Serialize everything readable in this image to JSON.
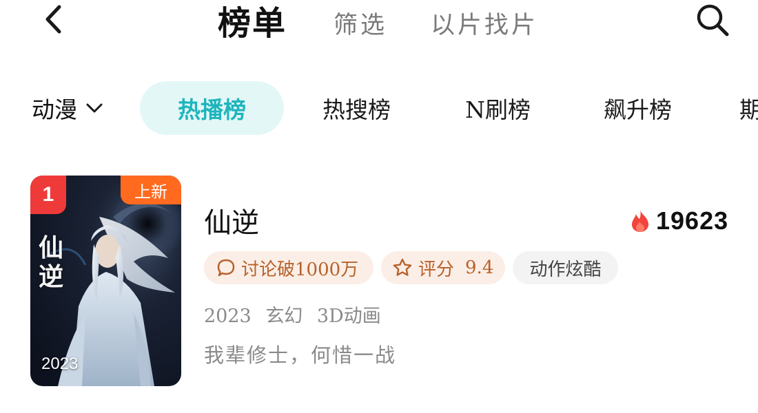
{
  "header": {
    "back_icon": "chevron-left-icon",
    "tabs": [
      {
        "label": "榜单",
        "active": true
      },
      {
        "label": "筛选",
        "active": false
      },
      {
        "label": "以片找片",
        "active": false
      }
    ],
    "search_icon": "search-icon"
  },
  "category_bar": {
    "selector_label": "动漫",
    "selector_icon": "chevron-down-icon",
    "tabs": [
      {
        "label": "热播榜",
        "active": true
      },
      {
        "label": "热搜榜",
        "active": false
      },
      {
        "label": "N刷榜",
        "active": false
      },
      {
        "label": "飙升榜",
        "active": false
      },
      {
        "label": "期",
        "active": false
      }
    ],
    "active_color": "#1fb5bd",
    "active_bg": "#e3f7f7"
  },
  "list": [
    {
      "rank": "1",
      "badge": "上新",
      "poster_year": "2023",
      "poster_title": "仙逆",
      "title": "仙逆",
      "heat_icon": "flame-icon",
      "heat": "19623",
      "tags": {
        "discuss": "讨论破1000万",
        "discuss_icon": "comment-icon",
        "score_label": "评分",
        "score_icon": "star-icon",
        "score_value": "9.4",
        "genre": "动作炫酷"
      },
      "meta": [
        "2023",
        "玄幻",
        "3D动画"
      ],
      "description": "我辈修士，何惜一战"
    }
  ],
  "colors": {
    "rank_badge": "#ef3a3a",
    "new_badge": "#ff6a1f",
    "heat_flame": "#f0443c",
    "warm_tag_text": "#b7612a",
    "warm_tag_bg": "#fbeee6"
  }
}
